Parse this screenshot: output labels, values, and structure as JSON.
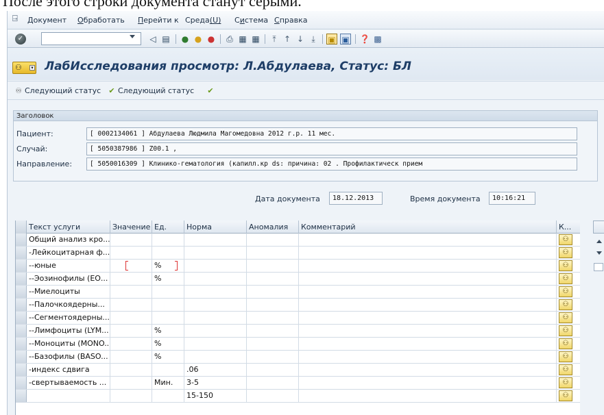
{
  "caption": "После этого строки документа станут серыми.",
  "menu": [
    "Документ",
    "Обработать",
    "Перейти к",
    "Среда(U)",
    "Система",
    "Справка"
  ],
  "title": "ЛабИсследования просмотр: Л.Абдулаева, Статус: БЛ",
  "app_toolbar": [
    "Следующий статус",
    "Следующий статус"
  ],
  "header": {
    "title": "Заголовок",
    "fields": [
      {
        "label": "Пациент:",
        "value": "[ 0002134061 ] Абдулаева Людмила Магомедовна 2012 г.р. 11  мес."
      },
      {
        "label": "Случай:",
        "value": "[ 5050387986 ] Z00.1 ,"
      },
      {
        "label": "Направление:",
        "value": "[ 5050016309 ] Клинико-гематология (капилл.кр ds: причина: 02 . Профилактическ прием"
      }
    ]
  },
  "document": {
    "date_label": "Дата документа",
    "date_value": "18.12.2013",
    "time_label": "Время документа",
    "time_value": "10:16:21"
  },
  "table": {
    "columns": [
      "Текст услуги",
      "Значение",
      "Ед.",
      "Норма",
      "Аномалия",
      "Комментарий",
      "К..."
    ],
    "rows": [
      {
        "text": "Общий анализ кро...",
        "value": "",
        "unit": "",
        "norm": ""
      },
      {
        "text": "-Лейкоцитарная ф...",
        "value": "",
        "unit": "",
        "norm": ""
      },
      {
        "text": "--юные",
        "value": "",
        "unit": "%",
        "norm": ""
      },
      {
        "text": "--Эозинофилы (ЕО...",
        "value": "",
        "unit": "%",
        "norm": ""
      },
      {
        "text": "--Миелоциты",
        "value": "",
        "unit": "",
        "norm": ""
      },
      {
        "text": "--Палочкоядерны...",
        "value": "",
        "unit": "",
        "norm": ""
      },
      {
        "text": "--Сегментоядерны...",
        "value": "",
        "unit": "",
        "norm": ""
      },
      {
        "text": "--Лимфоциты (LYM...",
        "value": "",
        "unit": "%",
        "norm": ""
      },
      {
        "text": "--Моноциты (MONO...",
        "value": "",
        "unit": "%",
        "norm": ""
      },
      {
        "text": "--Базофилы (BASO...",
        "value": "",
        "unit": "%",
        "norm": ""
      },
      {
        "text": "-индекс сдвига",
        "value": "",
        "unit": "",
        "norm": ".06"
      },
      {
        "text": "-свертываемость ...",
        "value": "",
        "unit": "Мин.",
        "norm": "3-5"
      },
      {
        "text": "",
        "value": "",
        "unit": "",
        "norm": "15-150"
      }
    ]
  }
}
